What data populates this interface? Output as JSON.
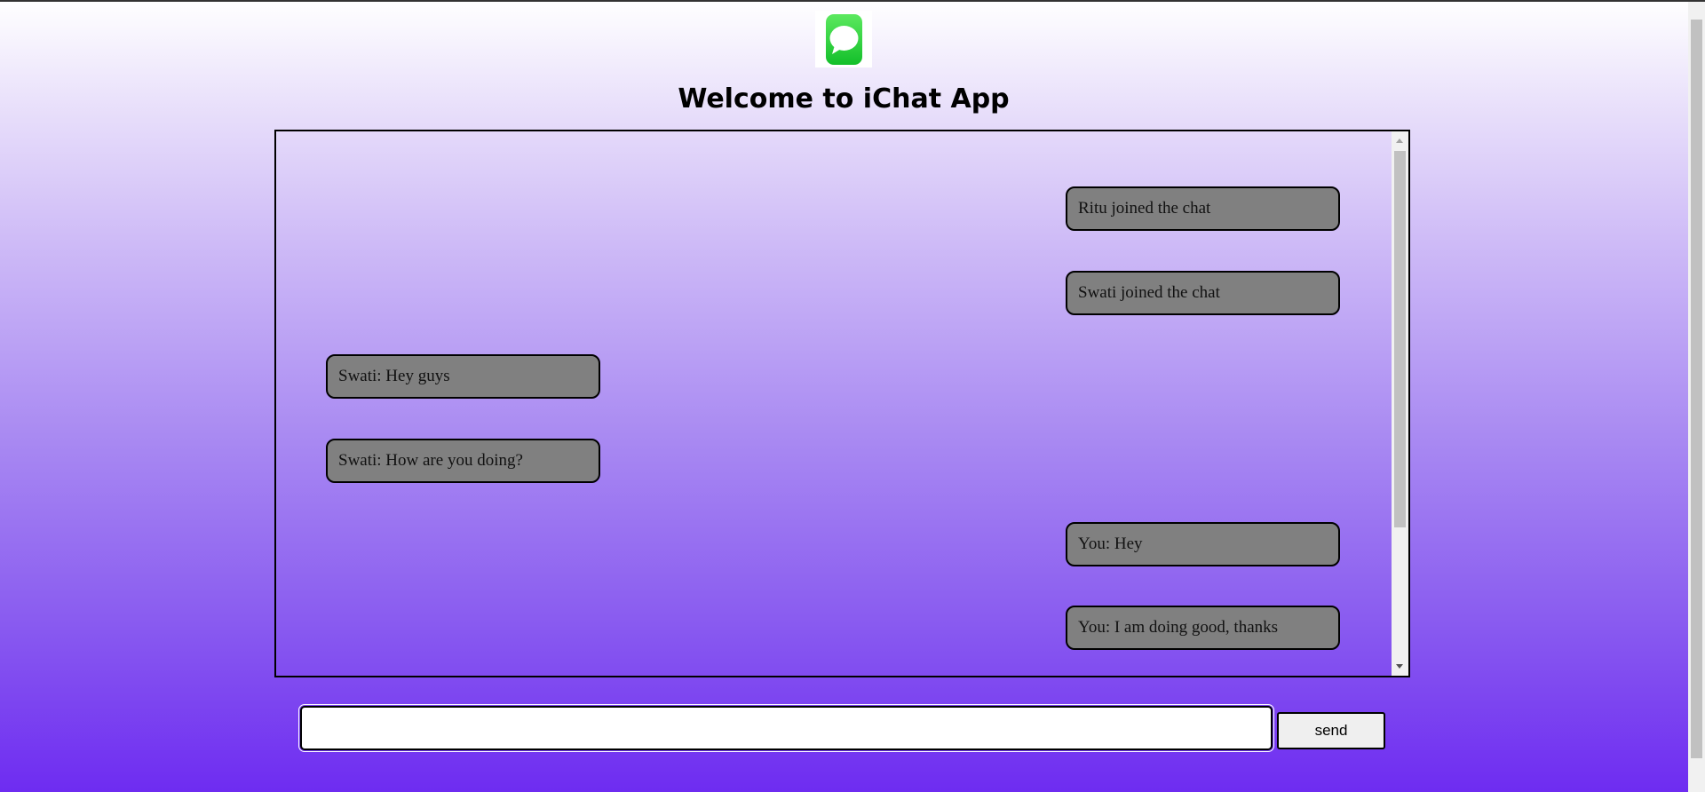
{
  "app": {
    "title": "Welcome to iChat App",
    "logo_icon": "chat-bubble-icon",
    "logo_colors": [
      "#5ce95f",
      "#13bf2a"
    ]
  },
  "chat": {
    "messages": [
      {
        "text": "Ritu joined the chat",
        "side": "right"
      },
      {
        "text": "Swati joined the chat",
        "side": "right"
      },
      {
        "text": "Swati: Hey guys",
        "side": "left"
      },
      {
        "text": "Swati: How are you doing?",
        "side": "left"
      },
      {
        "text": "You: Hey",
        "side": "right"
      },
      {
        "text": "You: I am doing good, thanks",
        "side": "right"
      }
    ],
    "bubble_color": "#808080"
  },
  "composer": {
    "input_value": "",
    "send_label": "send"
  }
}
